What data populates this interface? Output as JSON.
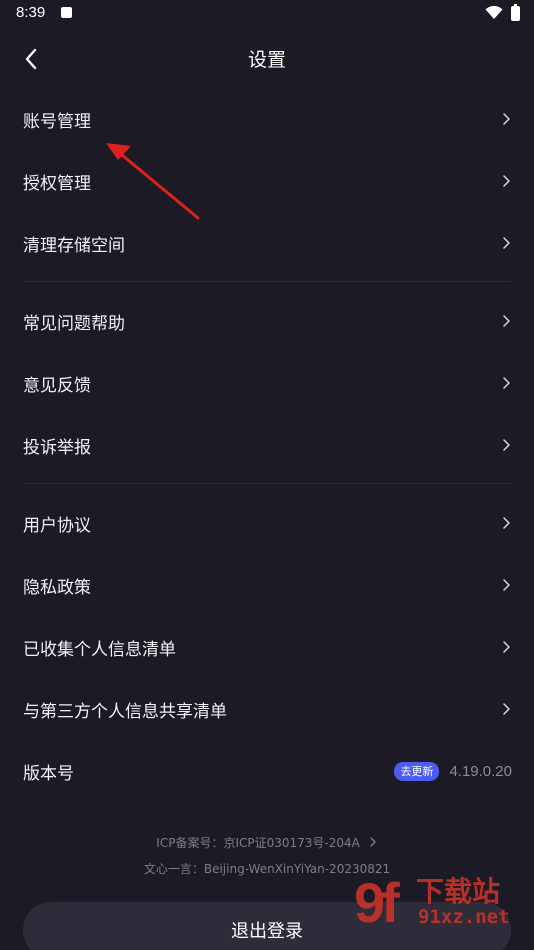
{
  "status_bar": {
    "time": "8:39"
  },
  "header": {
    "title": "设置"
  },
  "menu_groups": [
    [
      "账号管理",
      "授权管理",
      "清理存储空间"
    ],
    [
      "常见问题帮助",
      "意见反馈",
      "投诉举报"
    ],
    [
      "用户协议",
      "隐私政策",
      "已收集个人信息清单",
      "与第三方个人信息共享清单"
    ]
  ],
  "version": {
    "label": "版本号",
    "badge": "去更新",
    "value": "4.19.0.20"
  },
  "footer": {
    "icp": "ICP备案号：京ICP证030173号-204A",
    "model": "文心一言：Beijing-WenXinYiYan-20230821"
  },
  "logout_label": "退出登录",
  "watermark": {
    "logo": "9f",
    "title": "下载站",
    "domain": "91xz.net"
  },
  "colors": {
    "background": "#1b1a25",
    "badge": "#4b5cf0",
    "annotation_arrow": "#e0201c"
  },
  "icons": {
    "back": "chevron-left-icon",
    "row": "chevron-right-icon",
    "wifi": "wifi-icon",
    "battery": "battery-charging-icon"
  }
}
